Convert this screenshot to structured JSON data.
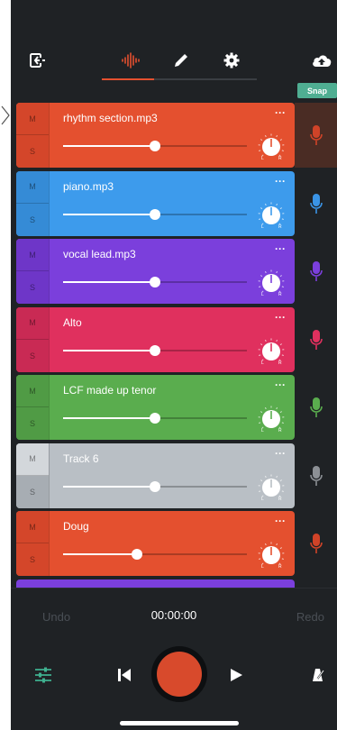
{
  "colors": {
    "background": "#1f2225",
    "accent": "#e4502f",
    "snap": "#4fae92",
    "tune": "#3fb08f"
  },
  "topbar": {
    "icons": [
      "exit-icon",
      "waveform-icon",
      "pencil-icon",
      "gear-icon",
      "cloud-upload-icon"
    ],
    "snap_label": "Snap"
  },
  "tracks": [
    {
      "name": "rhythm section.mp3",
      "color": "#e4502f",
      "ms_color": "#d4462a",
      "mute": "M",
      "solo": "S",
      "volume": 0.5,
      "mic_color": "#d04328",
      "armed": true
    },
    {
      "name": "piano.mp3",
      "color": "#3d9bec",
      "ms_color": "#358bd6",
      "mute": "M",
      "solo": "S",
      "volume": 0.5,
      "mic_color": "#3a94e6",
      "armed": false
    },
    {
      "name": "vocal lead.mp3",
      "color": "#7b3fdc",
      "ms_color": "#6e36c8",
      "mute": "M",
      "solo": "S",
      "volume": 0.5,
      "mic_color": "#7b3fdc",
      "armed": false
    },
    {
      "name": "Alto",
      "color": "#e0305e",
      "ms_color": "#c92a54",
      "mute": "M",
      "solo": "S",
      "volume": 0.5,
      "mic_color": "#e0305e",
      "armed": false
    },
    {
      "name": "LCF made up tenor",
      "color": "#5aad4e",
      "ms_color": "#509b45",
      "mute": "M",
      "solo": "S",
      "volume": 0.5,
      "mic_color": "#5aad4e",
      "armed": false
    },
    {
      "name": "Track 6",
      "color": "#b9bfc5",
      "ms_color": "#a7adb3",
      "mute": "M",
      "solo": "S",
      "volume": 0.5,
      "mic_color": "#8c9095",
      "armed": false,
      "muted_on": true
    },
    {
      "name": "Doug",
      "color": "#e4502f",
      "ms_color": "#d4462a",
      "mute": "M",
      "solo": "S",
      "volume": 0.4,
      "mic_color": "#d04328",
      "armed": false
    }
  ],
  "transport": {
    "undo_label": "Undo",
    "redo_label": "Redo",
    "time": "00:00:00",
    "icons": [
      "mixer-sliders-icon",
      "skip-back-icon",
      "record-button",
      "play-icon",
      "metronome-icon"
    ]
  }
}
